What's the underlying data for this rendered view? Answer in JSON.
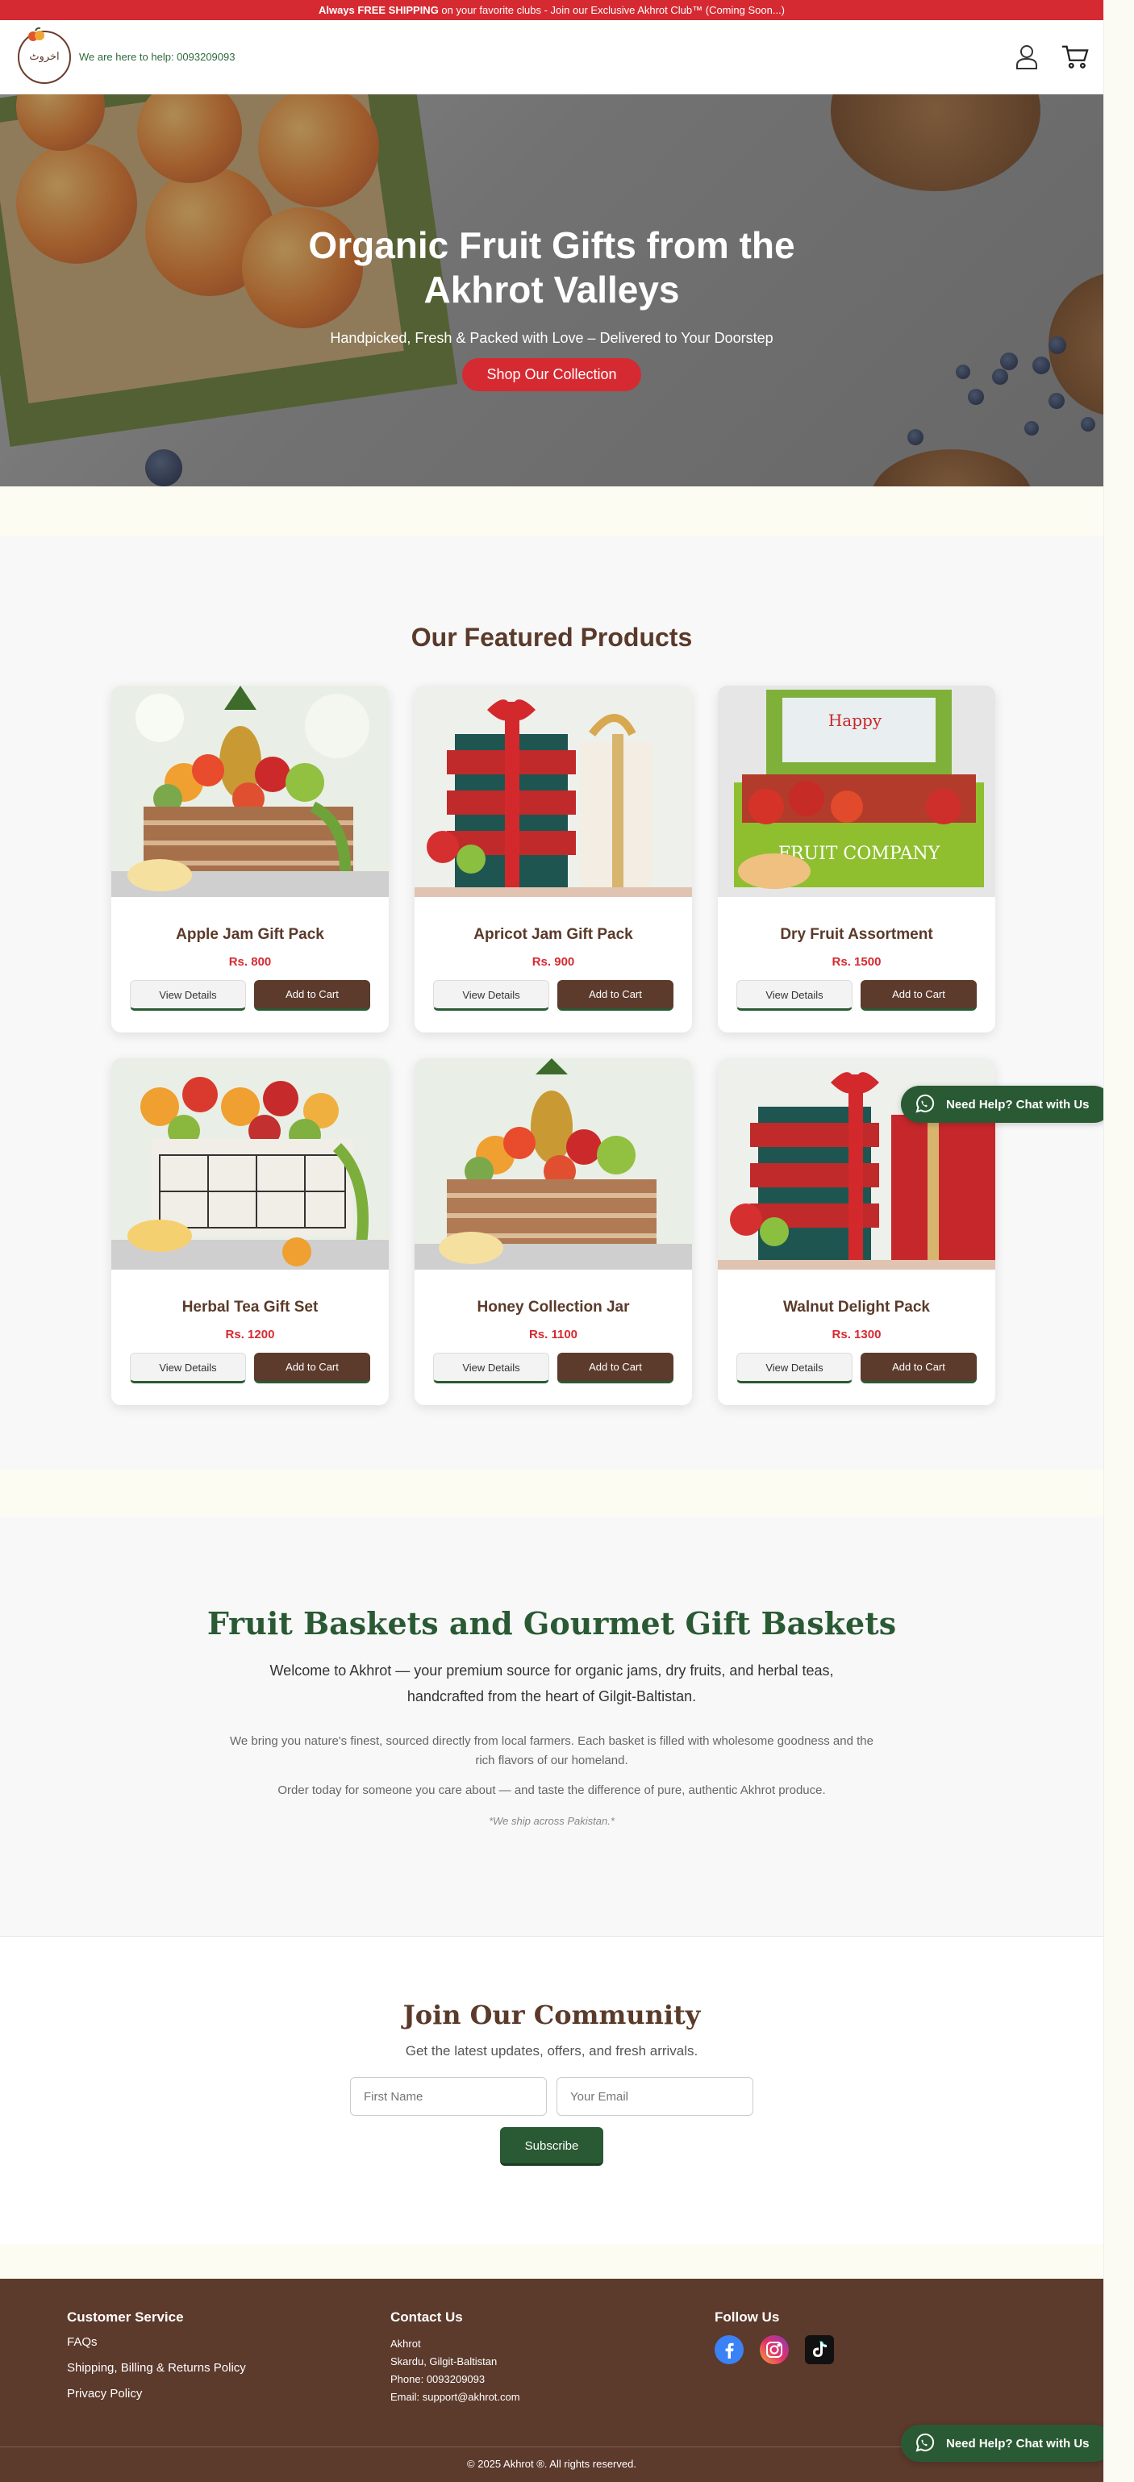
{
  "topbar": {
    "strong": "Always FREE SHIPPING",
    "rest": " on your favorite clubs - Join our Exclusive Akhrot Club™ (Coming Soon...)"
  },
  "header": {
    "logo_text": "اخروٹ",
    "helpline": "We are here to help: 0093209093",
    "icons": [
      "user-icon",
      "cart-icon"
    ]
  },
  "hero": {
    "title": "Organic Fruit Gifts from the Akhrot Valleys",
    "subtitle": "Handpicked, Fresh & Packed with Love – Delivered to Your Doorstep",
    "button": "Shop Our Collection"
  },
  "featured": {
    "title": "Our Featured Products",
    "view_label": "View Details",
    "cart_label": "Add to Cart",
    "products": [
      {
        "name": "Apple Jam Gift Pack",
        "price": "Rs. 800"
      },
      {
        "name": "Apricot Jam Gift Pack",
        "price": "Rs. 900"
      },
      {
        "name": "Dry Fruit Assortment",
        "price": "Rs. 1500"
      },
      {
        "name": "Herbal Tea Gift Set",
        "price": "Rs. 1200"
      },
      {
        "name": "Honey Collection Jar",
        "price": "Rs. 1100"
      },
      {
        "name": "Walnut Delight Pack",
        "price": "Rs. 1300"
      }
    ]
  },
  "about": {
    "title": "Fruit Baskets and Gourmet Gift Baskets",
    "lead": "Welcome to Akhrot — your premium source for organic jams, dry fruits, and herbal teas, handcrafted from the heart of Gilgit-Baltistan.",
    "p1": "We bring you nature's finest, sourced directly from local farmers. Each basket is filled with wholesome goodness and the rich flavors of our homeland.",
    "p2": "Order today for someone you care about — and taste the difference of pure, authentic Akhrot produce.",
    "note": "*We ship across Pakistan.*"
  },
  "community": {
    "title": "Join Our Community",
    "subtitle": "Get the latest updates, offers, and fresh arrivals.",
    "first_name_placeholder": "First Name",
    "email_placeholder": "Your Email",
    "button": "Subscribe"
  },
  "footer": {
    "customer_service": {
      "title": "Customer Service",
      "links": [
        "FAQs",
        "Shipping, Billing & Returns Policy",
        "Privacy Policy"
      ]
    },
    "contact": {
      "title": "Contact Us",
      "lines": [
        "Akhrot",
        "Skardu, Gilgit-Baltistan",
        "Phone: 0093209093",
        "Email: support@akhrot.com"
      ]
    },
    "follow": {
      "title": "Follow Us",
      "icons": [
        "facebook-icon",
        "instagram-icon",
        "tiktok-icon"
      ]
    },
    "copyright": "© 2025 Akhrot ®. All rights reserved."
  },
  "chat": {
    "label": "Need Help? Chat with Us"
  },
  "colors": {
    "brand_red": "#d62a32",
    "brand_brown": "#5c3a2c",
    "brand_green": "#2a5a34"
  }
}
